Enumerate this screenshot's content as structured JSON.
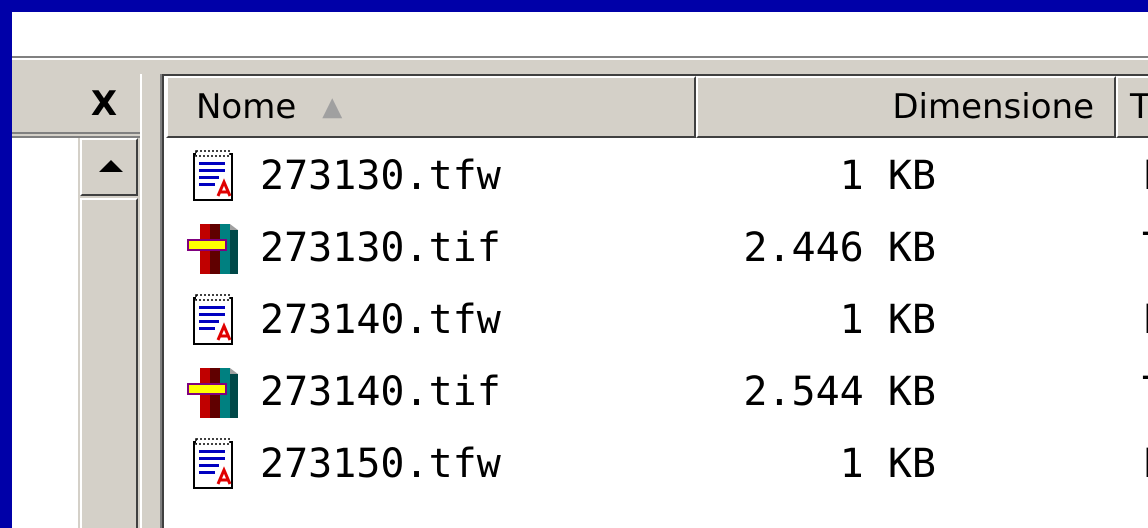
{
  "columns": {
    "name": "Nome",
    "size": "Dimensione",
    "type": "T"
  },
  "sort_indicator": "▲",
  "left_pane": {
    "close_label": "X"
  },
  "files": [
    {
      "name": "273130.tfw",
      "size": "1 KB",
      "type": "F",
      "icon": "text-document-icon"
    },
    {
      "name": "273130.tif",
      "size": "2.446 KB",
      "type": "T",
      "icon": "tif-image-icon"
    },
    {
      "name": "273140.tfw",
      "size": "1 KB",
      "type": "F",
      "icon": "text-document-icon"
    },
    {
      "name": "273140.tif",
      "size": "2.544 KB",
      "type": "T",
      "icon": "tif-image-icon"
    },
    {
      "name": "273150.tfw",
      "size": "1 KB",
      "type": "F",
      "icon": "text-document-icon"
    }
  ],
  "colors": {
    "frame": "#0000a8",
    "face": "#d4d0c8",
    "window": "#ffffff"
  }
}
